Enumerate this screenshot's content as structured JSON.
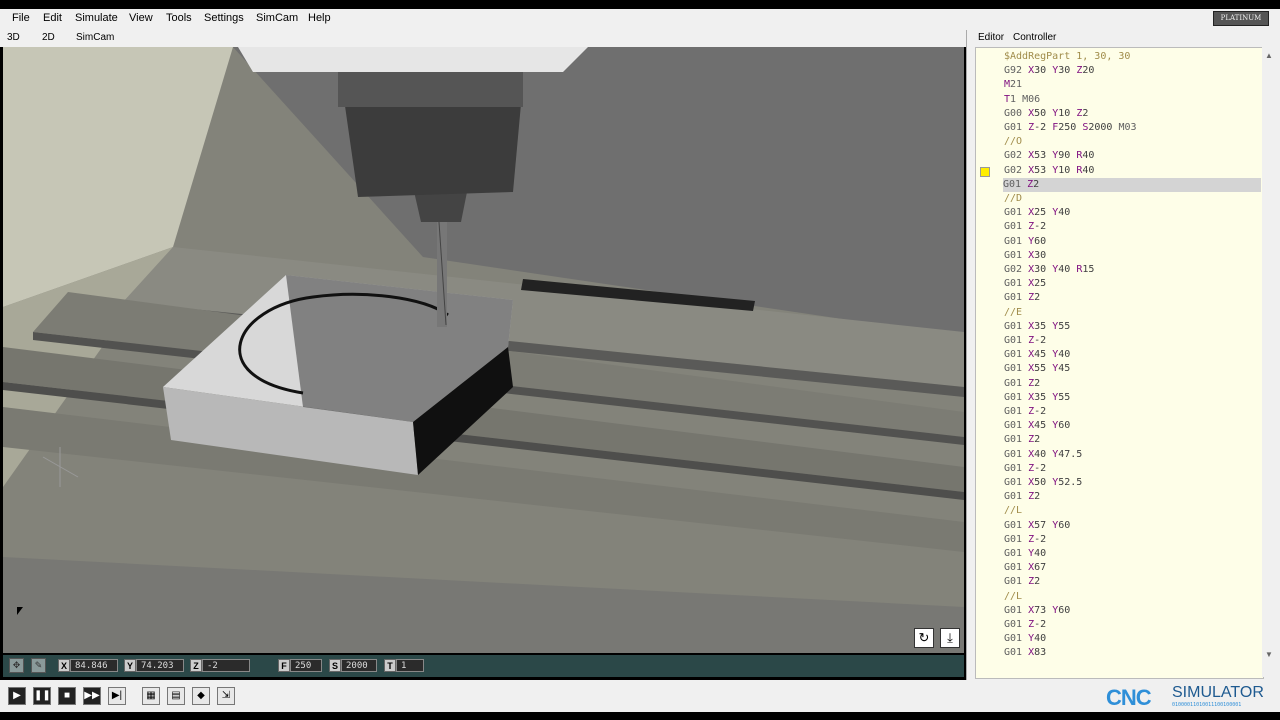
{
  "menu": [
    "File",
    "Edit",
    "Simulate",
    "View",
    "Tools",
    "Settings",
    "SimCam",
    "Help"
  ],
  "edition_badge": "PLATINUM EDITION",
  "view_tabs": [
    "3D",
    "2D",
    "SimCam"
  ],
  "right_tabs": [
    "Editor",
    "Controller"
  ],
  "code_lines": [
    "$AddRegPart 1, 30, 30",
    "G92 X30 Y30 Z20",
    "M21",
    "T1 M06",
    "G00 X50 Y10 Z2",
    "G01 Z-2 F250 S2000 M03",
    "//O",
    "G02 X53 Y90 R40",
    "G02 X53 Y10 R40",
    "G01 Z2",
    "//D",
    "G01 X25 Y40",
    "G01 Z-2",
    "G01 Y60",
    "G01 X30",
    "G02 X30 Y40 R15",
    "G01 X25",
    "G01 Z2",
    "//E",
    "G01 X35 Y55",
    "G01 Z-2",
    "G01 X45 Y40",
    "G01 X55 Y45",
    "G01 Z2",
    "G01 X35 Y55",
    "G01 Z-2",
    "G01 X45 Y60",
    "G01 Z2",
    "G01 X40 Y47.5",
    "G01 Z-2",
    "G01 X50 Y52.5",
    "G01 Z2",
    "//L",
    "G01 X57 Y60",
    "G01 Z-2",
    "G01 Y40",
    "G01 X67",
    "G01 Z2",
    "//L",
    "G01 X73 Y60",
    "G01 Z-2",
    "G01 Y40",
    "G01 X83"
  ],
  "highlighted_line": 9,
  "marker_line": 8,
  "status": {
    "x_label": "X",
    "x_value": "84.846",
    "y_label": "Y",
    "y_value": "74.203",
    "z_label": "Z",
    "z_value": "-2",
    "f_label": "F",
    "f_value": "250",
    "s_label": "S",
    "s_value": "2000",
    "t_label": "T",
    "t_value": "1"
  },
  "brand": {
    "text": "SIMULATOR",
    "prefix": "CNC",
    "binary": "01000011010011100100001"
  },
  "colors": {
    "gcode": "#606060",
    "address": "#801080",
    "comment": "#a08c4a",
    "highlight": "#d4d4d4",
    "editor_bg": "#fefee8"
  }
}
